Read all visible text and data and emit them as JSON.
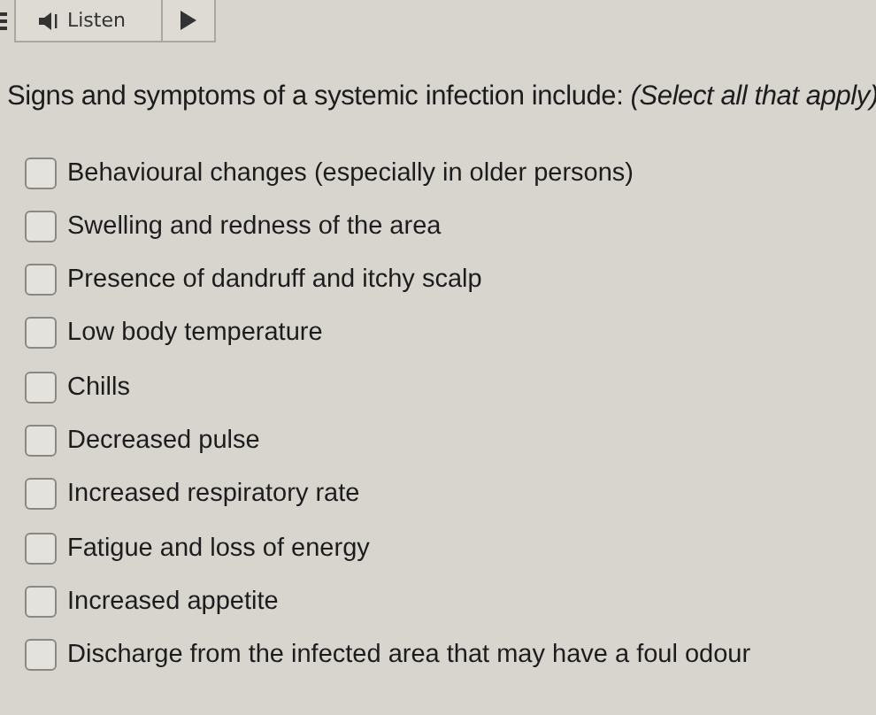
{
  "toolbar": {
    "listen_label": "Listen"
  },
  "question": "Signs and symptoms of a systemic infection include: *(Select all that apply)*",
  "options": [
    {
      "label": "Behavioural changes (especially in older persons)",
      "checked": false
    },
    {
      "label": "Swelling and redness of the area",
      "checked": false
    },
    {
      "label": "Presence of dandruff and itchy scalp",
      "checked": false
    },
    {
      "label": "Low body temperature",
      "checked": false
    },
    {
      "label": "Chills",
      "checked": false
    },
    {
      "label": "Decreased pulse",
      "checked": false
    },
    {
      "label": "Increased respiratory rate",
      "checked": false
    },
    {
      "label": "Fatigue and loss of energy",
      "checked": false
    },
    {
      "label": "Increased appetite",
      "checked": false
    },
    {
      "label": "Discharge from the infected area that may have a foul odour",
      "checked": false
    }
  ]
}
